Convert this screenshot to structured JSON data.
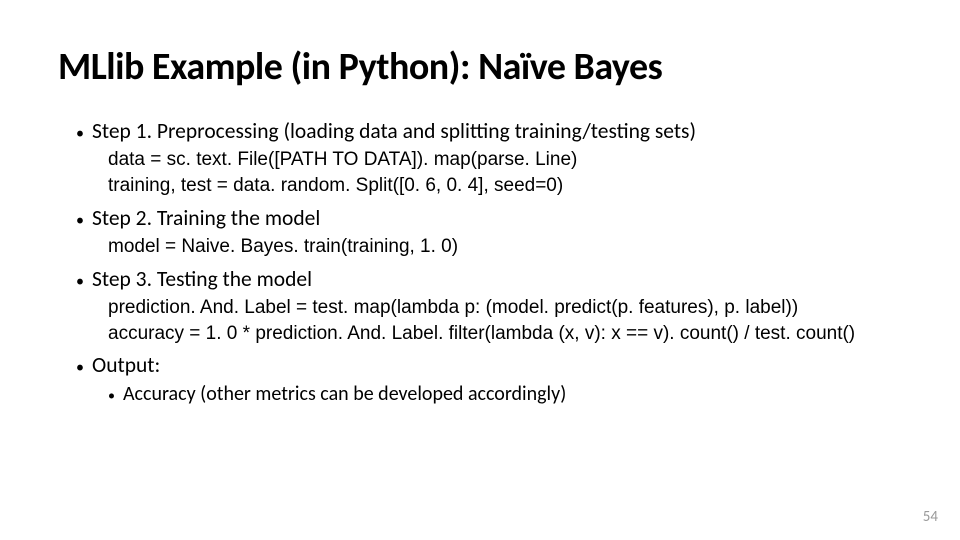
{
  "title": "MLlib Example (in Python): Naïve Bayes",
  "steps": [
    {
      "label": "Step 1. Preprocessing (loading data and splitting training/testing sets)",
      "code": [
        "data = sc. text. File([PATH TO DATA]). map(parse. Line)",
        "training, test = data. random. Split([0. 6, 0. 4], seed=0)"
      ]
    },
    {
      "label": "Step 2. Training the model",
      "code": [
        "model = Naive. Bayes. train(training, 1. 0)"
      ]
    },
    {
      "label": "Step 3. Testing the model",
      "code": [
        "prediction. And. Label = test. map(lambda p: (model. predict(p. features), p. label))",
        "accuracy = 1. 0 * prediction. And. Label. filter(lambda (x, v): x == v). count() / test. count()"
      ]
    },
    {
      "label": "Output:",
      "sub": [
        "Accuracy (other metrics can be developed accordingly)"
      ]
    }
  ],
  "page_number": "54"
}
